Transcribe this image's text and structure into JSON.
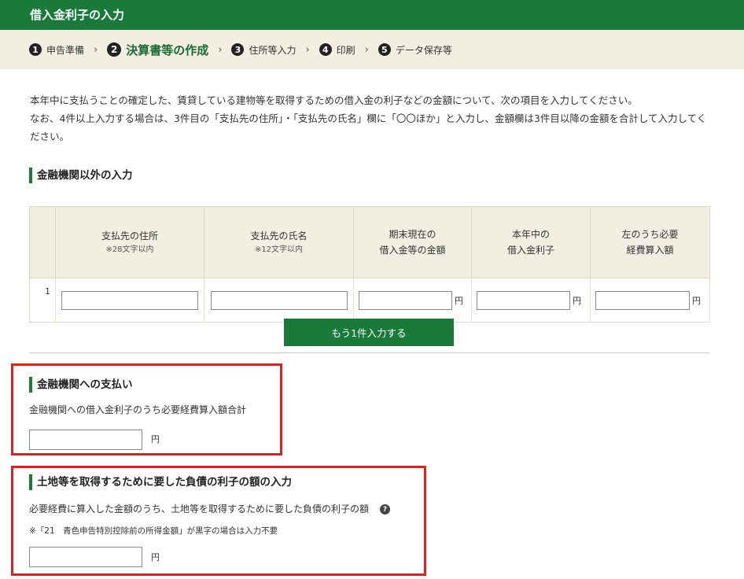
{
  "header": {
    "title": "借入金利子の入力"
  },
  "steps": [
    {
      "num": "1",
      "label": "申告準備"
    },
    {
      "num": "2",
      "label": "決算書等の作成"
    },
    {
      "num": "3",
      "label": "住所等入力"
    },
    {
      "num": "4",
      "label": "印刷"
    },
    {
      "num": "5",
      "label": "データ保存等"
    }
  ],
  "active_step": 2,
  "intro": {
    "line1": "本年中に支払うことの確定した、賃貸している建物等を取得するための借入金の利子などの金額について、次の項目を入力してください。",
    "line2": "なお、4件以上入力する場合は、3件目の「支払先の住所」・「支払先の氏名」欄に「〇〇ほか」と入力し、金額欄は3件目以降の金額を合計して入力してください。"
  },
  "section1": {
    "heading": "金融機関以外の入力",
    "columns": [
      {
        "line1": "支払先の住所",
        "sub": "※28文字以内"
      },
      {
        "line1": "支払先の氏名",
        "sub": "※12文字以内"
      },
      {
        "line1": "期末現在の",
        "line2": "借入金等の金額"
      },
      {
        "line1": "本年中の",
        "line2": "借入金利子"
      },
      {
        "line1": "左のうち必要",
        "line2": "経費算入額"
      }
    ],
    "row_number": "1",
    "yen": "円",
    "add_button": "もう1件入力する"
  },
  "section2": {
    "heading": "金融機関への支払い",
    "description": "金融機関への借入金利子のうち必要経費算入額合計",
    "yen": "円"
  },
  "section3": {
    "heading": "土地等を取得するために要した負債の利子の額の入力",
    "description": "必要経費に算入した金額のうち、土地等を取得するために要した負債の利子の額",
    "help": "?",
    "note": "※「21　青色申告特別控除前の所得金額」が黒字の場合は入力不要",
    "yen": "円"
  },
  "colors": {
    "primary_green": "#1a7a3a",
    "highlight_red": "#e02020",
    "header_beige": "#f2efe2"
  }
}
